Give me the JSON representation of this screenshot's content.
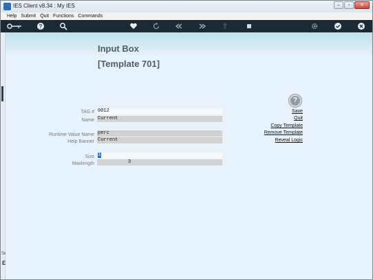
{
  "window": {
    "title": "IES Client v8.34 : My IES",
    "controls": [
      "–",
      "▫",
      "✕"
    ]
  },
  "menu": [
    "Help",
    "Submit",
    "Quit",
    "Functions",
    "Commands"
  ],
  "toolbar": {
    "icons": [
      "key-icon",
      "help-icon",
      "search-icon",
      "heart-icon",
      "refresh-icon",
      "rewind-icon",
      "forward-icon",
      "upload-icon",
      "stop-icon",
      "gear-icon",
      "check-icon",
      "close-icon"
    ]
  },
  "page": {
    "title": "Input Box",
    "subtitle": "[Template 701]"
  },
  "form": {
    "tag_label": "TAG #",
    "tag_value": "0012",
    "name_label": "Name",
    "name_value": "Current",
    "runtime_label": "Runtime Value Name",
    "runtime_value": "perc",
    "banner_label": "Help Banner",
    "banner_value": "Current",
    "size_label": "Size",
    "size_value": "3",
    "maxlength_label": "Maxlength",
    "maxlength_value": "3"
  },
  "actions": {
    "help_symbol": "?",
    "save": "Save",
    "quit": "Quit",
    "copy": "Copy Template",
    "remove": "Remove Template",
    "reveal": "Reveal Logic"
  },
  "leftbar": {
    "top_text": "Se",
    "bottom_text": "E"
  }
}
